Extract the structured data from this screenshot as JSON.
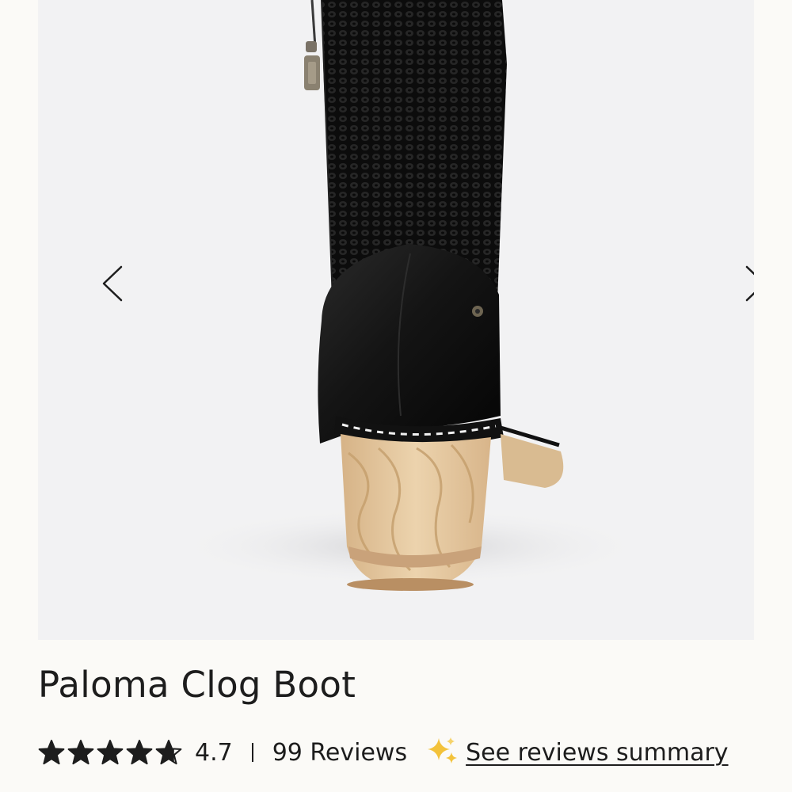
{
  "gallery": {
    "image_subject": "rear view of black crochet-knit clog boot with light wooden heel",
    "prev_icon": "chevron-left-icon",
    "next_icon": "chevron-right-icon"
  },
  "product": {
    "title": "Paloma Clog Boot",
    "rating": "4.7",
    "rating_value": 4.7,
    "rating_max": 5,
    "star_icon": "star-icon",
    "review_count": "99 Reviews",
    "summary_icon": "sparkle-icon",
    "summary_link": "See reviews summary"
  },
  "colors": {
    "background": "#fbfaf7",
    "image_bg": "#f2f2f3",
    "text": "#1d1d1d",
    "sparkle": "#f3c23a",
    "wood": "#e2c49a"
  }
}
